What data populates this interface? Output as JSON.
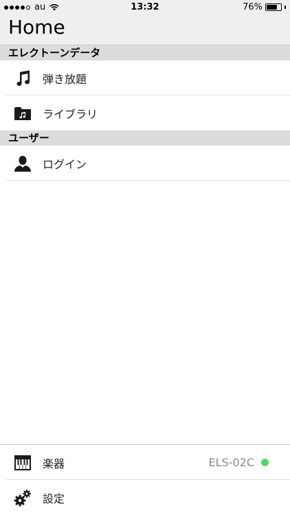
{
  "status_bar": {
    "carrier": "au",
    "time": "13:32",
    "battery_percent": "76%",
    "battery_level": 0.76
  },
  "header": {
    "title": "Home"
  },
  "sections": [
    {
      "title": "エレクトーンデータ",
      "items": [
        {
          "label": "弾き放題",
          "icon": "music-note-icon"
        },
        {
          "label": "ライブラリ",
          "icon": "folder-music-icon"
        }
      ]
    },
    {
      "title": "ユーザー",
      "items": [
        {
          "label": "ログイン",
          "icon": "user-icon"
        }
      ]
    }
  ],
  "bottom_menu": {
    "instrument": {
      "label": "楽器",
      "value": "ELS-02C",
      "status_color": "#4cd964",
      "icon": "keyboard-icon"
    },
    "settings": {
      "label": "設定",
      "icon": "gears-icon"
    }
  }
}
